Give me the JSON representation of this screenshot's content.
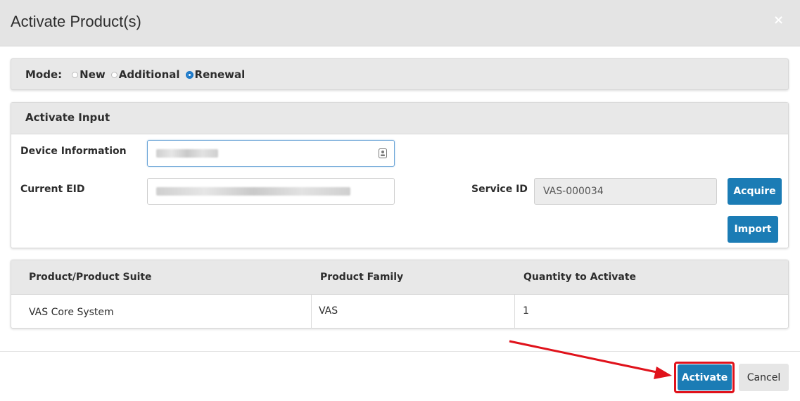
{
  "dialog": {
    "title": "Activate Product(s)",
    "close_label": "×"
  },
  "mode": {
    "label": "Mode:",
    "options": [
      {
        "label": "New",
        "checked": false
      },
      {
        "label": "Additional",
        "checked": false
      },
      {
        "label": "Renewal",
        "checked": true
      }
    ]
  },
  "activate_input": {
    "heading": "Activate Input",
    "device_info_label": "Device Information",
    "current_eid_label": "Current EID",
    "service_id_label": "Service ID",
    "service_id_value": "VAS-000034",
    "acquire_label": "Acquire",
    "import_label": "Import"
  },
  "table": {
    "headers": [
      "Product/Product Suite",
      "Product Family",
      "Quantity to Activate"
    ],
    "rows": [
      [
        "VAS Core System",
        "VAS",
        "1"
      ]
    ]
  },
  "footer": {
    "activate_label": "Activate",
    "cancel_label": "Cancel"
  },
  "colors": {
    "primary_button": "#1b7cb5",
    "highlight": "#e0121b",
    "radio_checked": "#1b78c8"
  },
  "icons": {
    "contact_card": "contact-card-icon",
    "close": "close-icon",
    "arrow": "annotation-arrow"
  }
}
